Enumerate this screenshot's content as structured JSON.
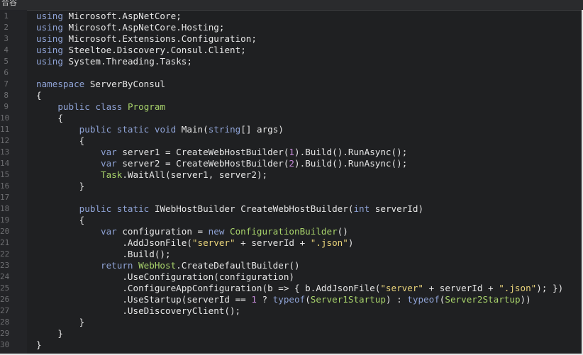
{
  "window": {
    "tab_label": "合谷"
  },
  "editor": {
    "language": "csharp",
    "colors": {
      "background": "#1f2022",
      "text": "#e6e6e6",
      "keyword": "#8fa3d6",
      "type": "#a8d36b",
      "string": "#ead47a",
      "number": "#c58ad8",
      "line_number": "#6e6f72"
    },
    "lines": [
      {
        "n": "1",
        "code": "using Microsoft.AspNetCore;"
      },
      {
        "n": "2",
        "code": "using Microsoft.AspNetCore.Hosting;"
      },
      {
        "n": "3",
        "code": "using Microsoft.Extensions.Configuration;"
      },
      {
        "n": "4",
        "code": "using Steeltoe.Discovery.Consul.Client;"
      },
      {
        "n": "5",
        "code": "using System.Threading.Tasks;"
      },
      {
        "n": "6",
        "code": ""
      },
      {
        "n": "7",
        "code": "namespace ServerByConsul"
      },
      {
        "n": "8",
        "code": "{"
      },
      {
        "n": "9",
        "code": "    public class Program"
      },
      {
        "n": "10",
        "code": "    {"
      },
      {
        "n": "11",
        "code": "        public static void Main(string[] args)"
      },
      {
        "n": "12",
        "code": "        {"
      },
      {
        "n": "13",
        "code": "            var server1 = CreateWebHostBuilder(1).Build().RunAsync();"
      },
      {
        "n": "14",
        "code": "            var server2 = CreateWebHostBuilder(2).Build().RunAsync();"
      },
      {
        "n": "15",
        "code": "            Task.WaitAll(server1, server2);"
      },
      {
        "n": "16",
        "code": "        }"
      },
      {
        "n": "17",
        "code": ""
      },
      {
        "n": "18",
        "code": "        public static IWebHostBuilder CreateWebHostBuilder(int serverId)"
      },
      {
        "n": "19",
        "code": "        {"
      },
      {
        "n": "20",
        "code": "            var configuration = new ConfigurationBuilder()"
      },
      {
        "n": "21",
        "code": "                .AddJsonFile(\"server\" + serverId + \".json\")"
      },
      {
        "n": "22",
        "code": "                .Build();"
      },
      {
        "n": "23",
        "code": "            return WebHost.CreateDefaultBuilder()"
      },
      {
        "n": "24",
        "code": "                .UseConfiguration(configuration)"
      },
      {
        "n": "25",
        "code": "                .ConfigureAppConfiguration(b => { b.AddJsonFile(\"server\" + serverId + \".json\"); })"
      },
      {
        "n": "26",
        "code": "                .UseStartup(serverId == 1 ? typeof(Server1Startup) : typeof(Server2Startup))"
      },
      {
        "n": "27",
        "code": "                .UseDiscoveryClient();"
      },
      {
        "n": "28",
        "code": "        }"
      },
      {
        "n": "29",
        "code": "    }"
      },
      {
        "n": "30",
        "code": "}"
      }
    ]
  }
}
